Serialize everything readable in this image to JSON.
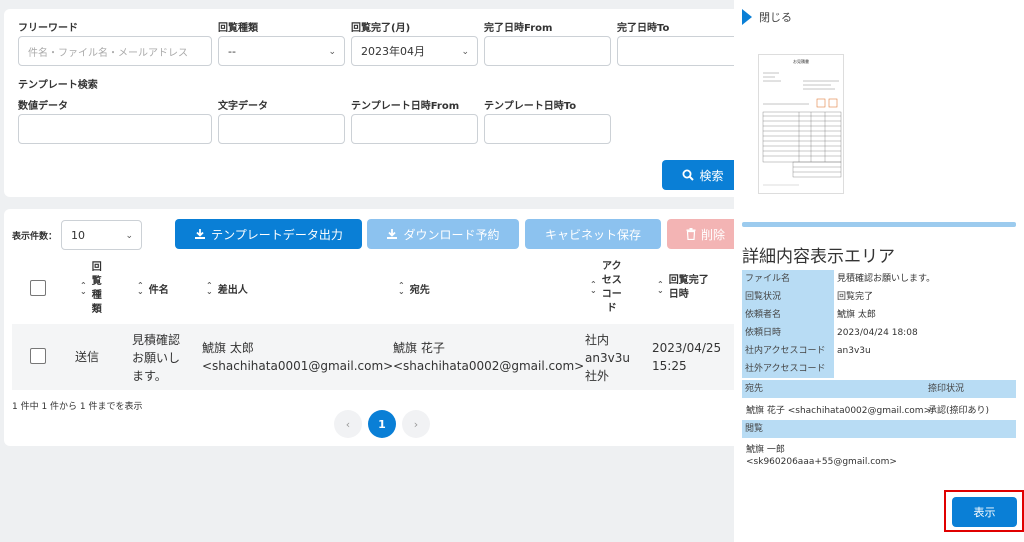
{
  "search": {
    "freeword_label": "フリーワード",
    "freeword_placeholder": "件名・ファイル名・メールアドレス",
    "type_label": "回覧種類",
    "type_value": "--",
    "month_label": "回覧完了(月)",
    "month_value": "2023年04月",
    "from_label": "完了日時From",
    "to_label": "完了日時To",
    "template_section": "テンプレート検索",
    "numeric_label": "数値データ",
    "text_label": "文字データ",
    "tpl_from_label": "テンプレート日時From",
    "tpl_to_label": "テンプレート日時To",
    "search_button": "検索"
  },
  "toolbar": {
    "count_label": "表示件数：",
    "count_value": "10",
    "export_button": "テンプレートデータ出力",
    "download_button": "ダウンロード予約",
    "cabinet_button": "キャビネット保存",
    "delete_button": "削除"
  },
  "table": {
    "headers": {
      "type": [
        "回",
        "覧",
        "種",
        "類"
      ],
      "subject": "件名",
      "sender": "差出人",
      "recipient": "宛先",
      "access": [
        "アク",
        "セス",
        "コー",
        "ド"
      ],
      "completed": [
        "回覧完了",
        "日時"
      ]
    },
    "rows": [
      {
        "type": "送信",
        "subject": [
          "見積確認",
          "お願いし",
          "ます。"
        ],
        "sender": [
          "鯱旗 太郎",
          "<shachihata0001@gmail.com>"
        ],
        "recipient": [
          "鯱旗 花子",
          "<shachihata0002@gmail.com>"
        ],
        "access": [
          "社内",
          "an3v3u",
          "社外"
        ],
        "completed": [
          "2023/04/25",
          "15:25"
        ]
      }
    ]
  },
  "pagination": {
    "summary": "1 件中 1 件から 1 件までを表示",
    "prev": "‹",
    "current": "1",
    "next": "›"
  },
  "detail": {
    "close_label": "閉じる",
    "section_title": "詳細内容表示エリア",
    "fields": [
      {
        "key": "ファイル名",
        "value": "見積確認お願いします。"
      },
      {
        "key": "回覧状況",
        "value": "回覧完了"
      },
      {
        "key": "依頼者名",
        "value": "鯱旗 太郎"
      },
      {
        "key": "依頼日時",
        "value": "2023/04/24 18:08"
      },
      {
        "key": "社内アクセスコード",
        "value": "an3v3u"
      },
      {
        "key": "社外アクセスコード",
        "value": ""
      }
    ],
    "dest_header": "宛先",
    "stamp_header": "捺印状況",
    "dest_value": "鯱旗 花子 <shachihata0002@gmail.com>",
    "stamp_value": "承認(捺印あり)",
    "viewer_header": "閲覧",
    "viewer_value": [
      "鯱旗 一郎",
      "<sk960206aaa+55@gmail.com>"
    ],
    "show_button": "表示",
    "doc_title": "お見積書"
  },
  "colors": {
    "primary": "#0a7fd6",
    "primary_light": "#8cc2ef",
    "danger_light": "#f3b4b4",
    "label_bg": "#b8dcf4",
    "highlight": "#e00000"
  }
}
